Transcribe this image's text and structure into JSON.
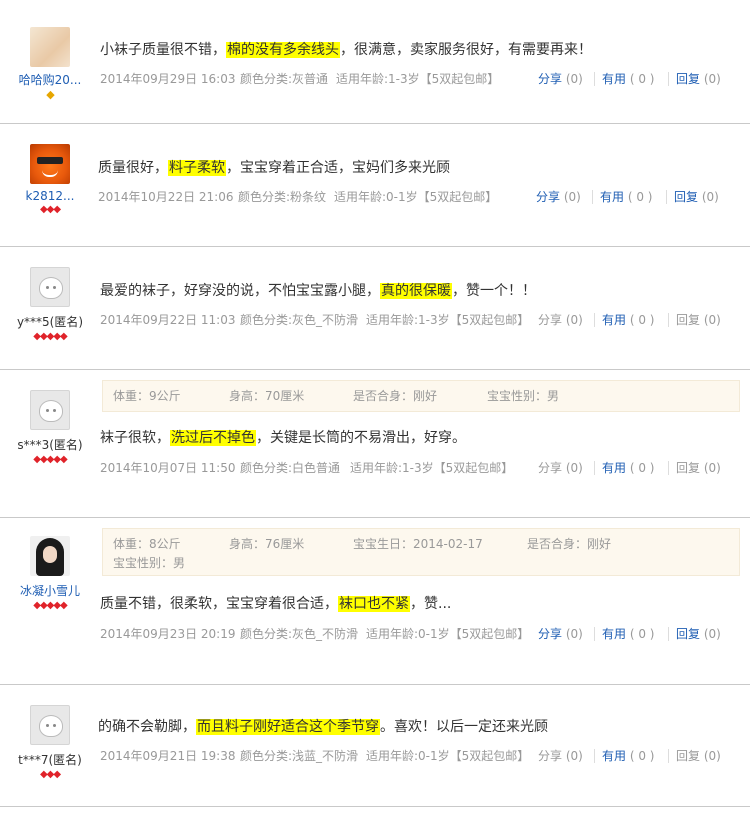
{
  "actions": {
    "share": "分享",
    "useful": "有用",
    "reply": "回复",
    "zero": "(0)",
    "useful_count": "( 0 )"
  },
  "reviews": [
    {
      "user": "哈哈购20...",
      "rank": "◆",
      "text_parts": [
        "小袜子质量很不错，",
        "棉的没有多余线头",
        "，很满意，卖家服务很好，有需要再来！"
      ],
      "date": "2014年09月29日 16:03",
      "color": "颜色分类:灰普通",
      "age": "适用年龄:1-3岁【5双起包邮】"
    },
    {
      "user": "k2812...",
      "rank": "◆◆◆",
      "text_parts": [
        "质量很好，",
        "料子柔软",
        "，宝宝穿着正合适，宝妈们多来光顾"
      ],
      "date": "2014年10月22日 21:06",
      "color": "颜色分类:粉条纹",
      "age": "适用年龄:0-1岁【5双起包邮】"
    },
    {
      "user": "y***5(匿名)",
      "rank": "◆◆◆◆◆",
      "text_parts": [
        "最爱的袜子，好穿没的说，不怕宝宝露小腿，",
        "真的很保暖",
        "，赞一个！！"
      ],
      "date": "2014年09月22日 11:03",
      "color": "颜色分类:灰色_不防滑",
      "age": "适用年龄:1-3岁【5双起包邮】"
    },
    {
      "user": "s***3(匿名)",
      "rank": "◆◆◆◆◆",
      "props": [
        "体重：9公斤",
        "身高：70厘米",
        "是否合身：刚好",
        "宝宝性别：男"
      ],
      "text_parts": [
        "袜子很软，",
        "洗过后不掉色",
        "，关键是长筒的不易滑出，好穿。"
      ],
      "date": "2014年10月07日 11:50",
      "color": "颜色分类:白色普通",
      "age": "适用年龄:1-3岁【5双起包邮】"
    },
    {
      "user": "冰凝小雪儿",
      "rank": "◆◆◆◆◆",
      "props": [
        "体重：8公斤",
        "身高：76厘米",
        "宝宝生日：2014-02-17",
        "是否合身：刚好",
        "宝宝性别：男"
      ],
      "text_parts": [
        "质量不错，很柔软，宝宝穿着很合适，",
        "袜口也不紧",
        "，赞..."
      ],
      "date": "2014年09月23日 20:19",
      "color": "颜色分类:灰色_不防滑",
      "age": "适用年龄:0-1岁【5双起包邮】"
    },
    {
      "user": "t***7(匿名)",
      "rank": "◆◆◆",
      "text_parts": [
        "的确不会勒脚，",
        "而且料子刚好适合这个季节穿",
        "。喜欢！以后一定还来光顾"
      ],
      "date": "2014年09月21日 19:38",
      "color": "颜色分类:浅蓝_不防滑",
      "age": "适用年龄:0-1岁【5双起包邮】"
    }
  ]
}
